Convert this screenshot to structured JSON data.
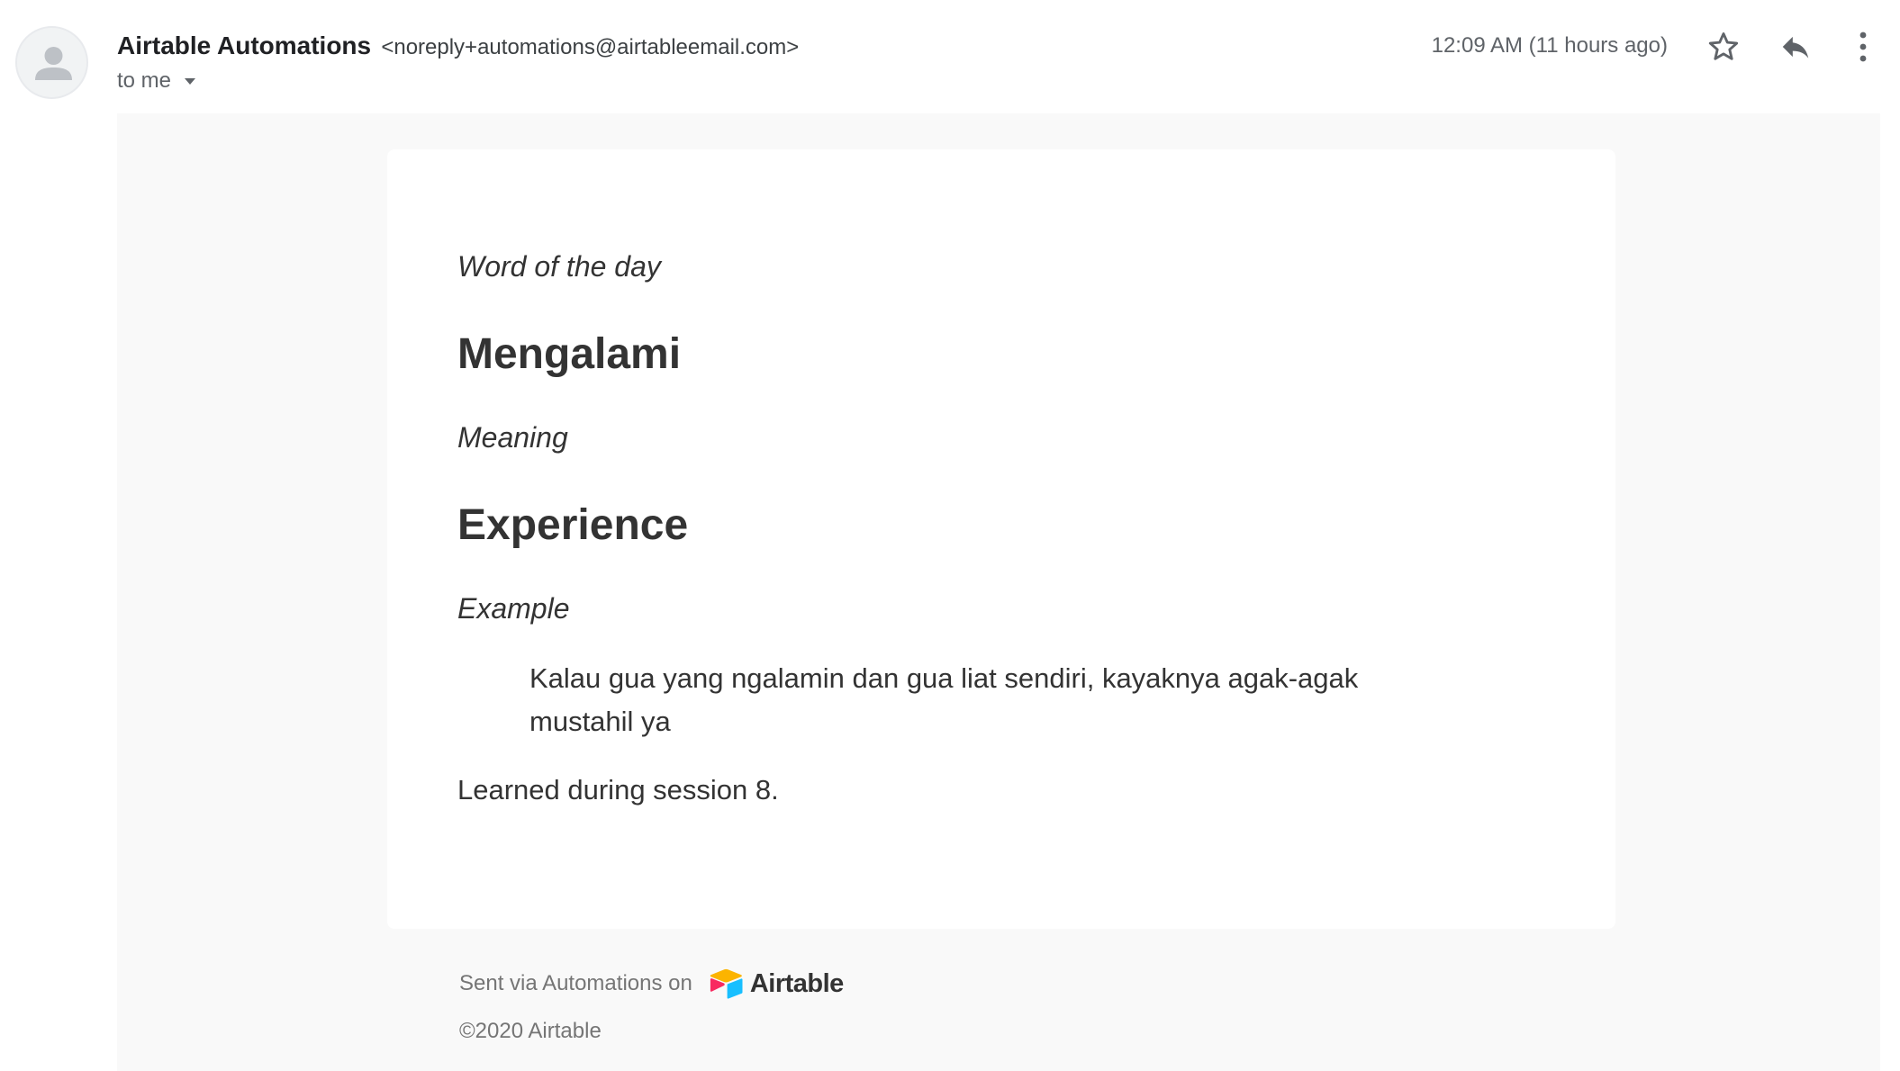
{
  "header": {
    "sender_name": "Airtable Automations",
    "sender_email": "<noreply+automations@airtableemail.com>",
    "recipient": "to me",
    "timestamp": "12:09 AM (11 hours ago)",
    "icons": {
      "avatar": "person-icon",
      "star": "star-icon",
      "reply": "reply-icon",
      "more": "more-vert-icon",
      "recipient_caret": "caret-down-icon"
    }
  },
  "message": {
    "word_label": "Word of the day",
    "word": "Mengalami",
    "meaning_label": "Meaning",
    "meaning": "Experience",
    "example_label": "Example",
    "example": "Kalau gua yang ngalamin dan gua liat sendiri, kayaknya agak-agak mustahil ya",
    "note": "Learned during session 8."
  },
  "footer": {
    "sent_via": "Sent via Automations on",
    "brand_name": "Airtable",
    "copyright": "©2020 Airtable"
  },
  "colors": {
    "body_background": "#f9f9f9",
    "card_background": "#ffffff",
    "text_primary": "#333333",
    "text_muted": "#757575",
    "airtable_yellow": "#fcb400",
    "airtable_red": "#f82b60",
    "airtable_blue": "#18bfff"
  }
}
